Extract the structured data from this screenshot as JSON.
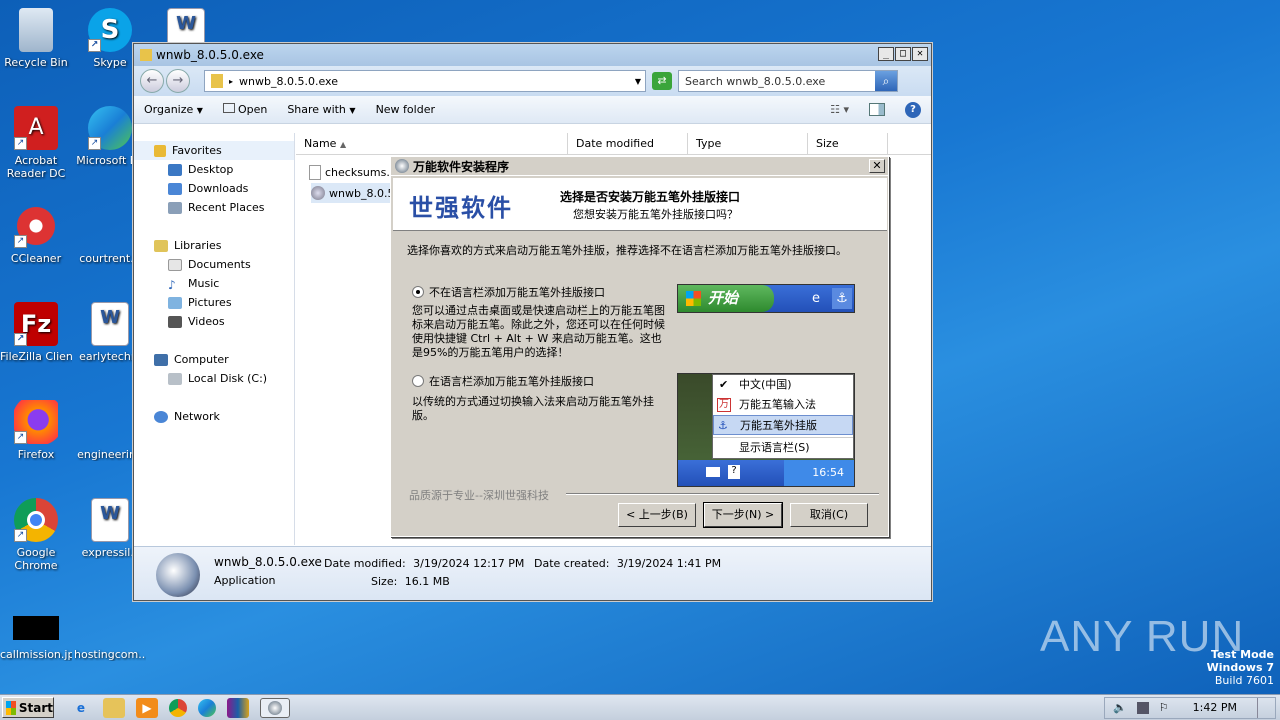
{
  "desktop": {
    "icons": [
      {
        "label": "Recycle Bin"
      },
      {
        "label": "Skype"
      },
      {
        "label": ""
      },
      {
        "label": "Acrobat Reader DC"
      },
      {
        "label": "Microsoft Ed"
      },
      {
        "label": "CCleaner"
      },
      {
        "label": "courtrent.p"
      },
      {
        "label": "FileZilla Client"
      },
      {
        "label": "earlytechni"
      },
      {
        "label": "Firefox"
      },
      {
        "label": "engineering"
      },
      {
        "label": "Google Chrome"
      },
      {
        "label": "expressil.r"
      },
      {
        "label": "callmission.jpg"
      },
      {
        "label": "hostingcom..."
      }
    ]
  },
  "explorer": {
    "title": "wnwb_8.0.5.0.exe",
    "address": "wnwb_8.0.5.0.exe",
    "search_placeholder": "Search wnwb_8.0.5.0.exe",
    "toolbar": {
      "organize": "Organize",
      "open": "Open",
      "share": "Share with",
      "new_folder": "New folder"
    },
    "nav": {
      "favorites": "Favorites",
      "desktop": "Desktop",
      "downloads": "Downloads",
      "recent": "Recent Places",
      "libraries": "Libraries",
      "documents": "Documents",
      "music": "Music",
      "pictures": "Pictures",
      "videos": "Videos",
      "computer": "Computer",
      "local_disk": "Local Disk (C:)",
      "network": "Network"
    },
    "columns": {
      "name": "Name",
      "date": "Date modified",
      "type": "Type",
      "size": "Size"
    },
    "files": [
      {
        "name": "checksums.t"
      },
      {
        "name": "wnwb_8.0.5"
      }
    ],
    "details": {
      "filename": "wnwb_8.0.5.0.exe",
      "kind": "Application",
      "modified_label": "Date modified:",
      "modified_value": "3/19/2024 12:17 PM",
      "created_label": "Date created:",
      "created_value": "3/19/2024 1:41 PM",
      "size_label": "Size:",
      "size_value": "16.1 MB"
    }
  },
  "dialog": {
    "title": "万能软件安装程序",
    "brand": "世强软件",
    "banner_title": "选择是否安装万能五笔外挂版接口",
    "banner_sub": "您想安装万能五笔外挂版接口吗？",
    "instruction": "选择你喜欢的方式来启动万能五笔外挂版，推荐选择不在语言栏添加万能五笔外挂版接口。",
    "option1": "不在语言栏添加万能五笔外挂版接口",
    "option1_desc": "您可以通过点击桌面或是快速启动栏上的万能五笔图标来启动万能五笔。除此之外，您还可以在任何时候使用快捷键 Ctrl + Alt + W 来启动万能五笔。这也是95%的万能五笔用户的选择！",
    "option2": "在语言栏添加万能五笔外挂版接口",
    "option2_desc": "以传统的方式通过切换输入法来启动万能五笔外挂版。",
    "preview_start": "开始",
    "menu_items": [
      "中文(中国)",
      "万能五笔输入法",
      "万能五笔外挂版",
      "显示语言栏(S)"
    ],
    "preview_time": "16:54",
    "footer": "品质源于专业--深圳世强科技",
    "back": "< 上一步(B)",
    "next": "下一步(N) >",
    "cancel": "取消(C)"
  },
  "taskbar": {
    "start": "Start",
    "time": "1:42 PM"
  },
  "watermark": {
    "line1": "Test Mode",
    "line2": "Windows 7",
    "line3": "Build 7601",
    "anyrun": "ANY RUN"
  }
}
